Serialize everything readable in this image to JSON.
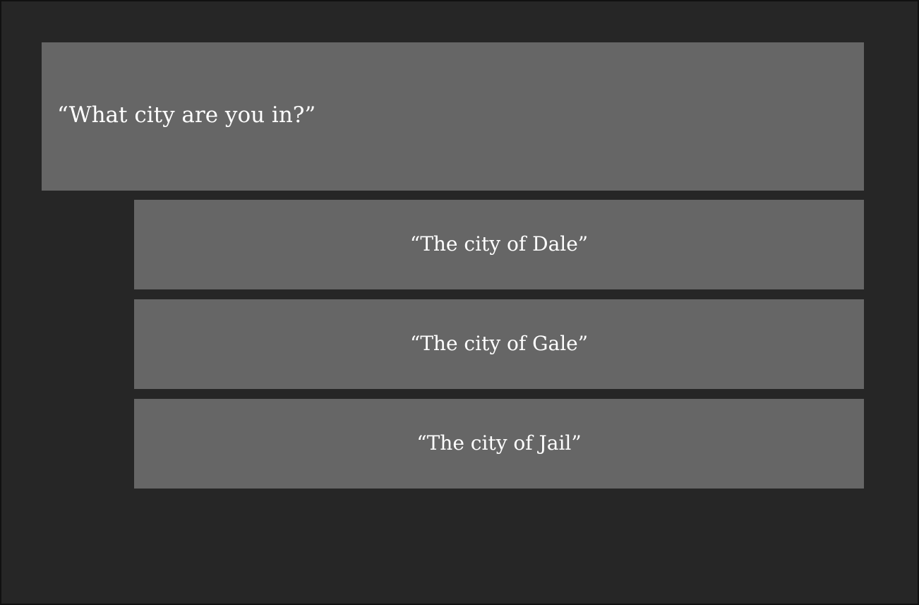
{
  "dialog": {
    "prompt": "“What city are you in?”",
    "options": [
      {
        "label": "“The city of Dale”"
      },
      {
        "label": "“The city of Gale”"
      },
      {
        "label": "“The city of Jail”"
      }
    ]
  },
  "colors": {
    "background": "#262626",
    "panel": "#666666",
    "text": "#ffffff",
    "border": "#111111"
  }
}
